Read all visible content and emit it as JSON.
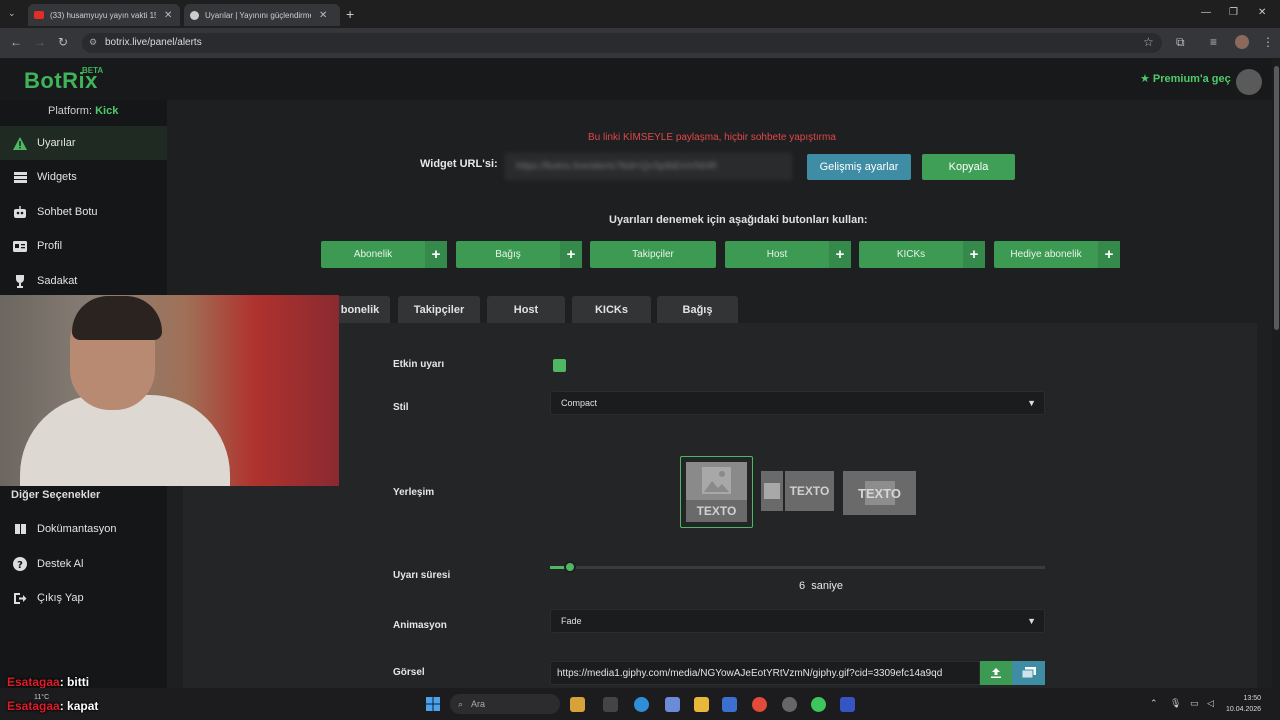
{
  "browser": {
    "tabs": [
      {
        "title": "(33) husamyuyu yayın vakti 15",
        "active": false
      },
      {
        "title": "Uyarılar | Yayınını güçlendirmek",
        "active": true
      }
    ],
    "url": "botrix.live/panel/alerts"
  },
  "app": {
    "logo": "BotRix",
    "beta": "BETA",
    "premium_label": "Premium'a geç"
  },
  "sidebar": {
    "platform_prefix": "Platform:",
    "platform_name": "Kick",
    "items": [
      {
        "label": "Uyarılar",
        "icon": "warning-icon"
      },
      {
        "label": "Widgets",
        "icon": "list-icon"
      },
      {
        "label": "Sohbet Botu",
        "icon": "robot-icon"
      },
      {
        "label": "Profil",
        "icon": "id-card-icon"
      },
      {
        "label": "Sadakat",
        "icon": "trophy-icon"
      }
    ],
    "other_heading": "Diğer Seçenekler",
    "other_items": [
      {
        "label": "Dokümantasyon",
        "icon": "book-icon"
      },
      {
        "label": "Destek Al",
        "icon": "question-icon"
      },
      {
        "label": "Çıkış Yap",
        "icon": "logout-icon"
      }
    ]
  },
  "main": {
    "warning": "Bu linki KİMSEYLE paylaşma, hiçbir sohbete yapıştırma",
    "widget_url_label": "Widget URL'si:",
    "widget_url_value": "https://botrix.live/alerts?bid=QvSpIbEmVNHR",
    "advanced_button": "Gelişmiş ayarlar",
    "copy_button": "Kopyala",
    "test_label": "Uyarıları denemek için aşağıdaki butonları kullan:",
    "test_buttons": [
      {
        "label": "Abonelik",
        "plus": true
      },
      {
        "label": "Bağış",
        "plus": true
      },
      {
        "label": "Takipçiler",
        "plus": false
      },
      {
        "label": "Host",
        "plus": true
      },
      {
        "label": "KICKs",
        "plus": true
      },
      {
        "label": "Hediye abonelik",
        "plus": true
      }
    ],
    "alert_tabs": [
      "bonelik",
      "Takipçiler",
      "Host",
      "KICKs",
      "Bağış"
    ],
    "form": {
      "enabled_label": "Etkin uyarı",
      "enabled": true,
      "style_label": "Stil",
      "style_value": "Compact",
      "layout_label": "Yerleşim",
      "layout_text": "TEXTO",
      "layout_selected_index": 0,
      "duration_label": "Uyarı süresi",
      "duration_value": "6",
      "duration_unit": "saniye",
      "duration_fraction": 0.04,
      "animation_label": "Animasyon",
      "animation_value": "Fade",
      "image_label": "Görsel",
      "image_url": "https://media1.giphy.com/media/NGYowAJeEotYRtVzmN/giphy.gif?cid=3309efc14a9qd"
    }
  },
  "chat_overlay": [
    {
      "user": "Esatagaa",
      "message": ": bitti"
    },
    {
      "user": "Esatagaa",
      "message": ": kapat"
    }
  ],
  "taskbar": {
    "temperature": "11°C",
    "search_placeholder": "Ara",
    "time": "13:50",
    "date": "10.04.2026"
  },
  "colors": {
    "accent_green": "#3fb45a",
    "button_blue": "#3f8ca5",
    "warning_red": "#e04848"
  }
}
